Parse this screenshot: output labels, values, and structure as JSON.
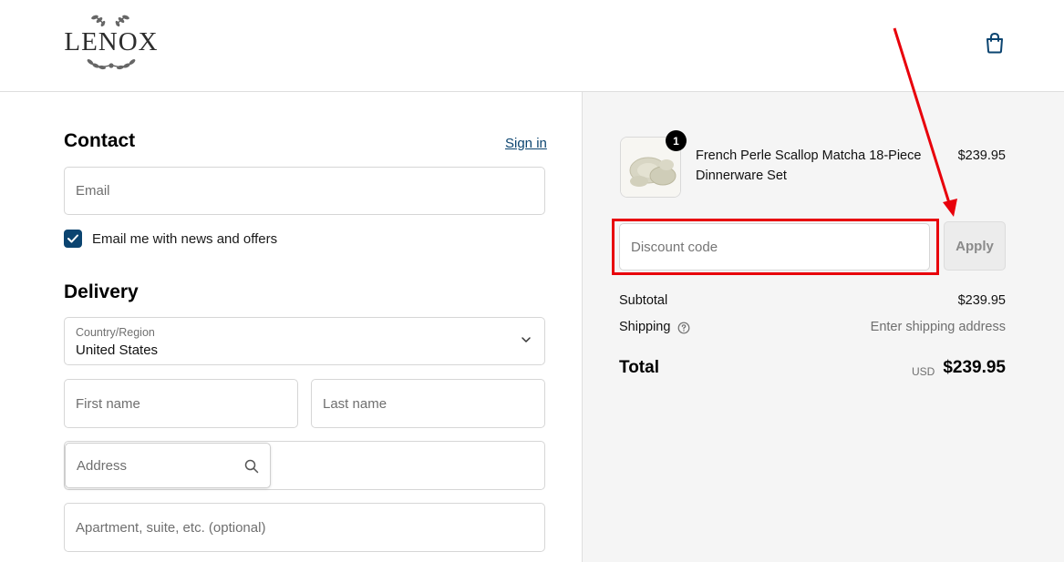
{
  "brand": {
    "logo_text": "LENOX"
  },
  "header": {
    "cart_icon": "shopping-bag-icon"
  },
  "contact": {
    "heading": "Contact",
    "sign_in": "Sign in",
    "email_placeholder": "Email",
    "newsletter_label": "Email me with news and offers",
    "newsletter_checked": true
  },
  "delivery": {
    "heading": "Delivery",
    "country_label": "Country/Region",
    "country_value": "United States",
    "first_name_placeholder": "First name",
    "last_name_placeholder": "Last name",
    "address_placeholder": "Address",
    "apartment_placeholder": "Apartment, suite, etc. (optional)"
  },
  "order": {
    "item": {
      "quantity": "1",
      "name": "French Perle Scallop Matcha 18-Piece Dinnerware Set",
      "price": "$239.95"
    },
    "discount_placeholder": "Discount code",
    "apply_label": "Apply",
    "subtotal_label": "Subtotal",
    "subtotal_value": "$239.95",
    "shipping_label": "Shipping",
    "shipping_value": "Enter shipping address",
    "total_label": "Total",
    "total_currency": "USD",
    "total_value": "$239.95"
  },
  "colors": {
    "accent": "#0b4470",
    "annotation": "#e8000b",
    "sidebar_bg": "#f5f5f5"
  }
}
